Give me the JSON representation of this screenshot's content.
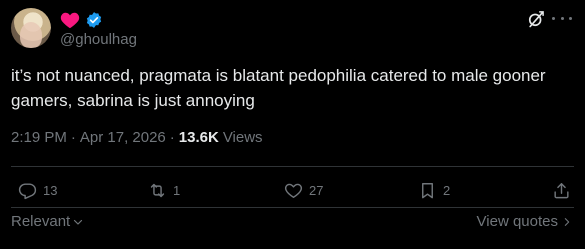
{
  "author": {
    "handle": "@ghoulhag",
    "name_emoji": "heart",
    "verified": true,
    "colors": {
      "heart": "#f91880",
      "verified": "#1d9bf0"
    }
  },
  "tweet": {
    "text": "it’s not nuanced, pragmata is blatant pedophilia catered to male gooner gamers, sabrina is just annoying",
    "time": "2:19 PM",
    "separator": "·",
    "date": "Apr 17, 2026",
    "views_count": "13.6K",
    "views_label": "Views"
  },
  "actions": {
    "replies": "13",
    "reposts": "1",
    "likes": "27",
    "bookmarks": "2"
  },
  "footer": {
    "sort_label": "Relevant",
    "view_quotes": "View quotes"
  },
  "icons": [
    "grok-icon",
    "more-icon",
    "reply-icon",
    "repost-icon",
    "like-icon",
    "bookmark-icon",
    "share-icon",
    "chevron-down-icon",
    "chevron-right-icon"
  ]
}
